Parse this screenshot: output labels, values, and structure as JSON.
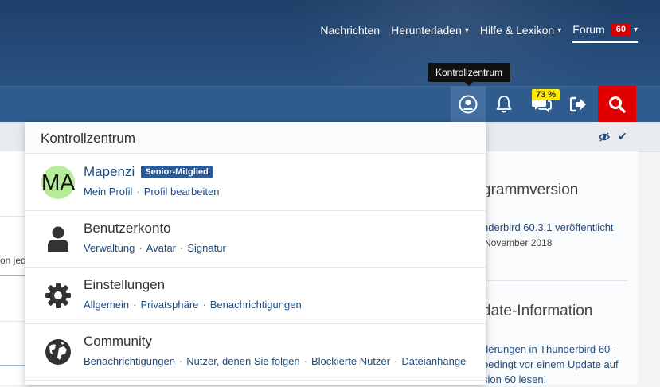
{
  "nav": {
    "items": [
      {
        "label": "Nachrichten",
        "dropdown": false
      },
      {
        "label": "Herunterladen",
        "dropdown": true
      },
      {
        "label": "Hilfe & Lexikon",
        "dropdown": true
      },
      {
        "label": "Forum",
        "dropdown": true,
        "badge": "60"
      }
    ]
  },
  "toolbar": {
    "tooltip": "Kontrollzentrum",
    "chat_badge": "73 %"
  },
  "panel": {
    "title": "Kontrollzentrum",
    "user": {
      "avatar_initials": "MA",
      "name": "Mapenzi",
      "rank": "Senior-Mitglied",
      "links": [
        "Mein Profil",
        "Profil bearbeiten"
      ]
    },
    "sections": [
      {
        "title": "Benutzerkonto",
        "icon": "user-icon",
        "links": [
          "Verwaltung",
          "Avatar",
          "Signatur"
        ]
      },
      {
        "title": "Einstellungen",
        "icon": "gear-icon",
        "links": [
          "Allgemein",
          "Privatsphäre",
          "Benachrichtigungen"
        ]
      },
      {
        "title": "Community",
        "icon": "globe-icon",
        "links": [
          "Benachrichtigungen",
          "Nutzer, denen Sie folgen",
          "Blockierte Nutzer",
          "Dateianhänge"
        ]
      }
    ]
  },
  "sidebar": {
    "box1_title": "grammversion",
    "box1_link": "nderbird 60.3.1 veröffentlicht",
    "box1_date": "November 2018",
    "box2_title": "date-Information",
    "box2_link_lines": [
      "derungen in Thunderbird 60 -",
      "bedingt vor einem Update auf",
      "sion 60 lesen!"
    ]
  },
  "background": {
    "left_fragment": "on jed"
  },
  "colors": {
    "accent": "#1f4c80",
    "header": "#1f3f68",
    "search": "#e00000",
    "badge_red": "#d40000",
    "badge_yellow": "#ffea00",
    "avatar": "#b5ec98"
  }
}
